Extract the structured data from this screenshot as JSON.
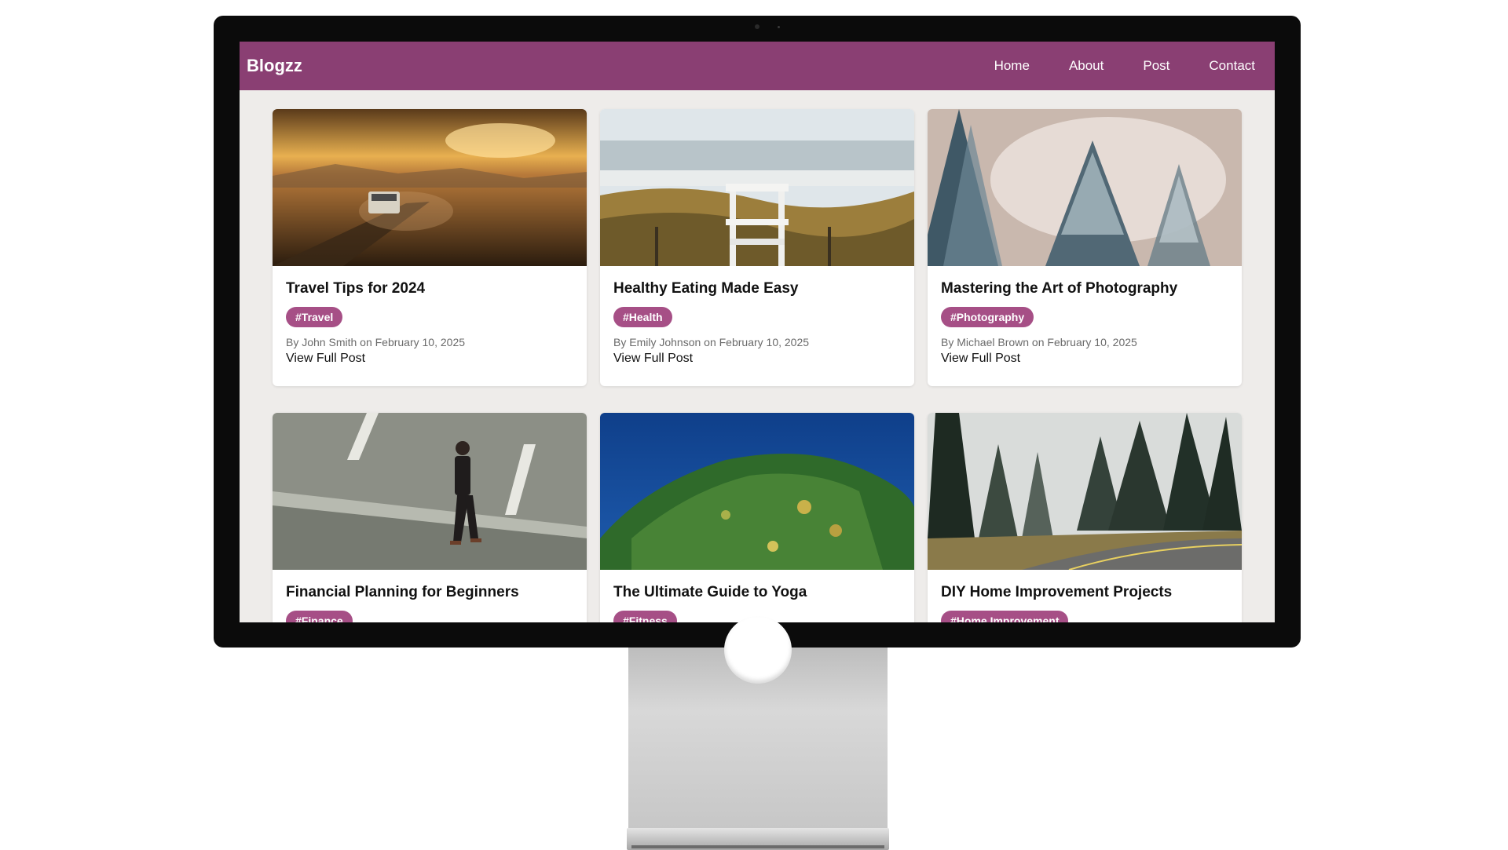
{
  "brand": "Blogzz",
  "nav": {
    "home": "Home",
    "about": "About",
    "post": "Post",
    "contact": "Contact"
  },
  "posts": [
    {
      "title": "Travel Tips for 2024",
      "tag": "#Travel",
      "meta": "By John Smith on February 10, 2025",
      "link": "View Full Post",
      "image": "desert road at sunset with van"
    },
    {
      "title": "Healthy Eating Made Easy",
      "tag": "#Health",
      "meta": "By Emily Johnson on February 10, 2025",
      "link": "View Full Post",
      "image": "white lifeguard chair on grassy dunes by sea"
    },
    {
      "title": "Mastering the Art of Photography",
      "tag": "#Photography",
      "meta": "By Michael Brown on February 10, 2025",
      "link": "View Full Post",
      "image": "snowy pine trees in mist"
    },
    {
      "title": "Financial Planning for Beginners",
      "tag": "#Finance",
      "image": "man in suit walking on road"
    },
    {
      "title": "The Ultimate Guide to Yoga",
      "tag": "#Fitness",
      "image": "aerial view of forested island in blue sea"
    },
    {
      "title": "DIY Home Improvement Projects",
      "tag": "#Home Improvement",
      "image": "road curving through foggy forest"
    }
  ]
}
